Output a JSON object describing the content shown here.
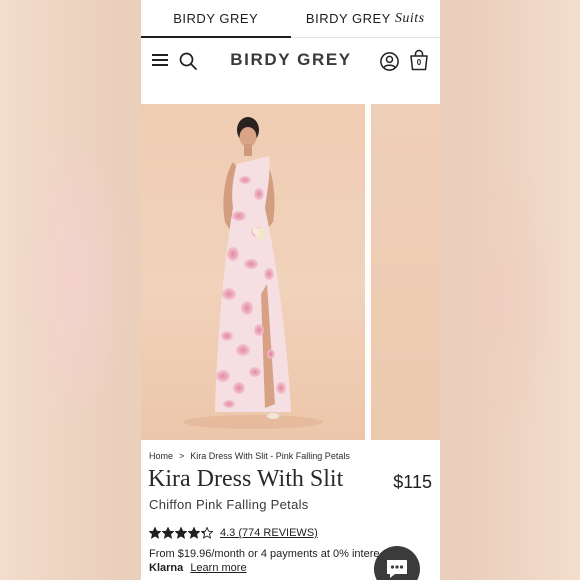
{
  "brand_tabs": [
    {
      "label": "BIRDY GREY",
      "active": true
    },
    {
      "label": "BIRDY GREY",
      "accent": "Suits",
      "active": false
    }
  ],
  "header": {
    "logo": "BIRDY GREY",
    "bag_count": "0",
    "icons": [
      "menu-icon",
      "search-icon",
      "account-icon",
      "shopping-bag-icon"
    ]
  },
  "product": {
    "breadcrumb": {
      "home": "Home",
      "separator": ">",
      "current": "Kira Dress With Slit - Pink Falling Petals"
    },
    "title": "Kira Dress With Slit",
    "price": "$115",
    "subtitle": "Chiffon Pink Falling Petals",
    "rating_value": 4.3,
    "rating_max": 5,
    "reviews_text": "4.3 (774 REVIEWS)",
    "financing_text": "From $19.96/month or 4 payments at 0% intere",
    "klarna_label": "Klarna",
    "learn_more": "Learn more"
  },
  "colors": {
    "text": "#1f1f1f",
    "logo": "#3a3a3a",
    "image_background": "#efcdb3",
    "chat_button": "#3b3b3b",
    "dress_pink": "#e8a5b5"
  }
}
